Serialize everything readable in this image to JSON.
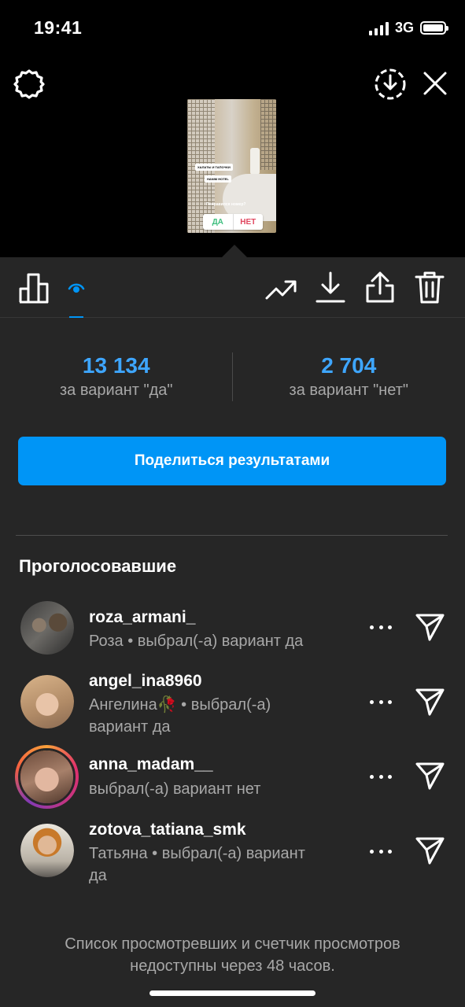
{
  "status_bar": {
    "time": "19:41",
    "network": "3G"
  },
  "story_preview": {
    "stickers": [
      "ХАЛАТЫ И ТАПОЧКИ",
      "HANIM HOTEL"
    ],
    "question": "Понравился номер?",
    "poll_yes": "ДА",
    "poll_no": "НЕТ"
  },
  "results": {
    "yes_count": "13 134",
    "yes_label": "за вариант \"да\"",
    "no_count": "2 704",
    "no_label": "за вариант \"нет\""
  },
  "share_button": "Поделиться результатами",
  "voters_title": "Проголосовавшие",
  "voters": [
    {
      "username": "roza_armani_",
      "subtitle": "Роза • выбрал(-а) вариант да"
    },
    {
      "username": "angel_ina8960",
      "subtitle": "Ангелина🥀 • выбрал(-а) вариант да"
    },
    {
      "username": "anna_madam__",
      "subtitle": "выбрал(-а) вариант нет"
    },
    {
      "username": "zotova_tatiana_smk",
      "subtitle": "Татьяна • выбрал(-а) вариант да"
    }
  ],
  "footer_note": "Список просмотревших и счетчик просмотров недоступны через 48 часов.",
  "colors": {
    "accent": "#0095f6",
    "count": "#3ea6ff",
    "background": "#262626"
  }
}
